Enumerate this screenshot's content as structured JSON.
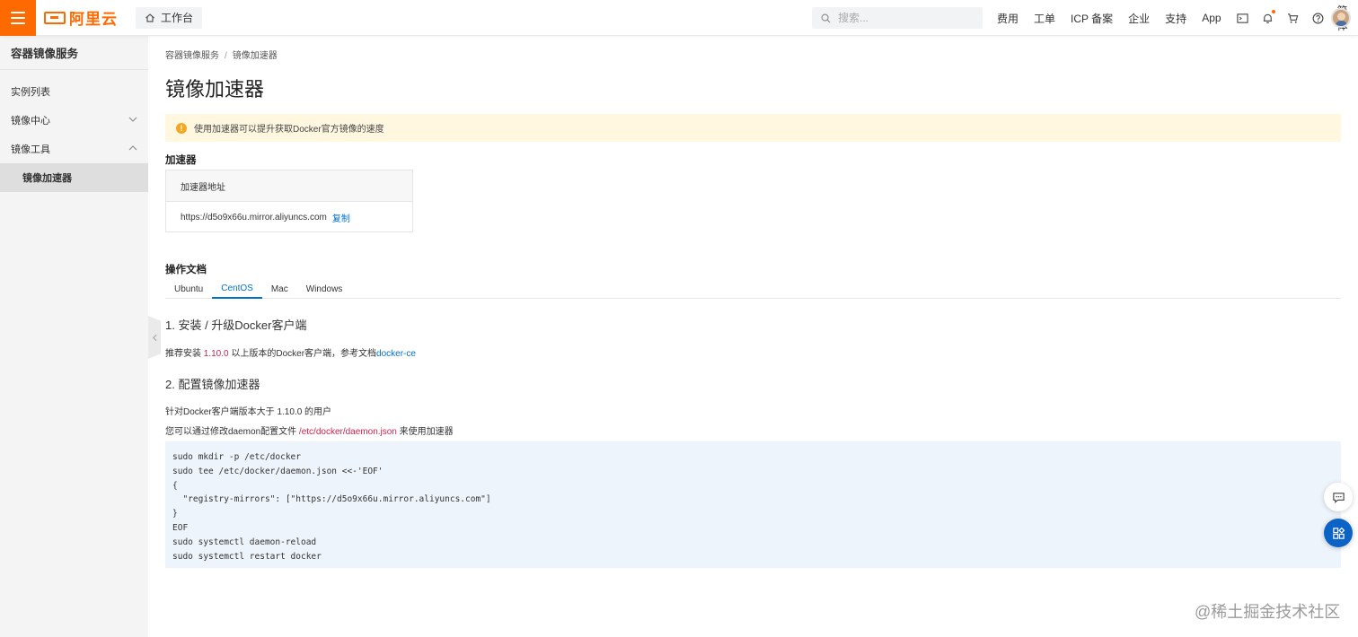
{
  "header": {
    "brand": "阿里云",
    "workbench_label": "工作台",
    "search_placeholder": "搜索...",
    "nav": [
      "费用",
      "工单",
      "ICP 备案",
      "企业",
      "支持",
      "App"
    ],
    "lang": "简体"
  },
  "sidebar": {
    "title": "容器镜像服务",
    "items": [
      {
        "label": "实例列表"
      },
      {
        "label": "镜像中心"
      },
      {
        "label": "镜像工具"
      }
    ],
    "sub_active": "镜像加速器"
  },
  "main": {
    "breadcrumb": [
      "容器镜像服务",
      "镜像加速器"
    ],
    "title": "镜像加速器",
    "notice": "使用加速器可以提升获取Docker官方镜像的速度",
    "accelerator_heading": "加速器",
    "accelerator_col": "加速器地址",
    "accelerator_url": "https://d5o9x66u.mirror.aliyuncs.com",
    "copy_label": "复制",
    "docs_heading": "操作文档",
    "tabs": [
      "Ubuntu",
      "CentOS",
      "Mac",
      "Windows"
    ],
    "step1_title": "1. 安装 / 升级Docker客户端",
    "step1_text_a": "推荐安装 ",
    "step1_version": "1.10.0",
    "step1_text_b": " 以上版本的Docker客户端，参考文档",
    "step1_link": "docker-ce",
    "step2_title": "2. 配置镜像加速器",
    "step2_text1": "针对Docker客户端版本大于 1.10.0 的用户",
    "step2_text2_a": "您可以通过修改daemon配置文件 ",
    "step2_path": "/etc/docker/daemon.json",
    "step2_text2_b": " 来使用加速器",
    "code": "sudo mkdir -p /etc/docker\nsudo tee /etc/docker/daemon.json <<-'EOF'\n{\n  \"registry-mirrors\": [\"https://d5o9x66u.mirror.aliyuncs.com\"]\n}\nEOF\nsudo systemctl daemon-reload\nsudo systemctl restart docker"
  },
  "watermark": "@稀土掘金技术社区",
  "colors": {
    "brand": "#ff6a00",
    "link": "#0070cc",
    "notice_bg": "#fff7e0",
    "code_bg": "#eef4fc"
  }
}
